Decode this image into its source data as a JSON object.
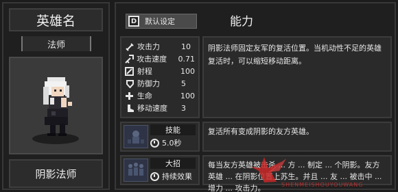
{
  "hero": {
    "name_header": "英雄名",
    "class": "法师",
    "title": "阴影法师"
  },
  "toolbar": {
    "key_glyph": "D",
    "default_label": "默认设定"
  },
  "ability": {
    "title": "能力",
    "description": "阴影法师固定友军的复活位置。当机动性不足的英雄复活时，可以缩短移动距离。"
  },
  "stats": [
    {
      "icon": "sword-icon",
      "label": "攻击力",
      "value": "10"
    },
    {
      "icon": "attack-speed-icon",
      "label": "攻击速度",
      "value": "0.71"
    },
    {
      "icon": "range-icon",
      "label": "射程",
      "value": "100"
    },
    {
      "icon": "shield-icon",
      "label": "防御力",
      "value": "5"
    },
    {
      "icon": "cross-icon",
      "label": "生命",
      "value": "100"
    },
    {
      "icon": "boot-icon",
      "label": "移动速度",
      "value": "3"
    }
  ],
  "skills": [
    {
      "type_label": "技能",
      "cooldown": "5.0秒",
      "description": "复活所有变成阴影的友方英雄。"
    },
    {
      "type_label": "大招",
      "cooldown": "持续效果",
      "description": "每当友方英雄被击杀 ... 方 ... 制定 ... 个阴影。友方英雄 ... 在阴影位置上苏生。并且 ... 友 ... 被击中 ... 增力 ... 攻击力。"
    }
  ],
  "watermark": {
    "text": "SHENMEISHOUYOUWANG"
  },
  "colors": {
    "background": "#1c1c1c",
    "panel": "#2a2a2a",
    "border": "#3c3c3c",
    "text": "#e8e8e8",
    "watermark": "#c83030"
  }
}
